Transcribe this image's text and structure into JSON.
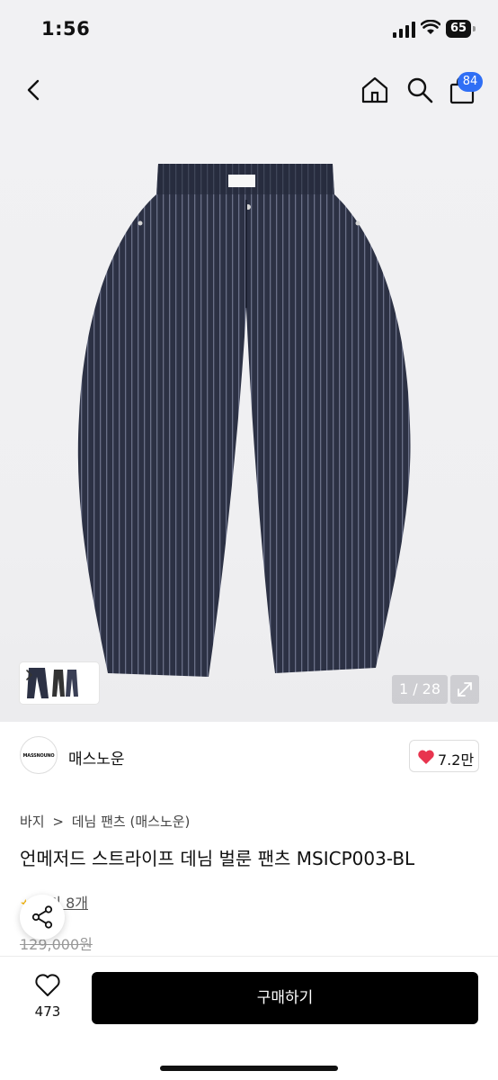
{
  "status_bar": {
    "time": "1:56",
    "battery": "65"
  },
  "header": {
    "cart_badge": "84"
  },
  "gallery": {
    "counter": "1 / 28"
  },
  "brand": {
    "logo_text": "MASSNOUNO",
    "name": "매스노운",
    "likes": "7.2만"
  },
  "breadcrumb": {
    "level1": "바지",
    "separator": ">",
    "level2": "데님 팬츠 (매스노운)"
  },
  "product": {
    "title": "언메저드 스트라이프 데님 벌룬 팬츠 MSICP003-BL",
    "review_label": "후기 8개",
    "original_price": "129,000원"
  },
  "bottom_bar": {
    "wish_count": "473",
    "buy_label": "구매하기"
  },
  "colors": {
    "accent_blue": "#2f6ff5",
    "heart_red": "#e8344e",
    "button_black": "#000000"
  }
}
